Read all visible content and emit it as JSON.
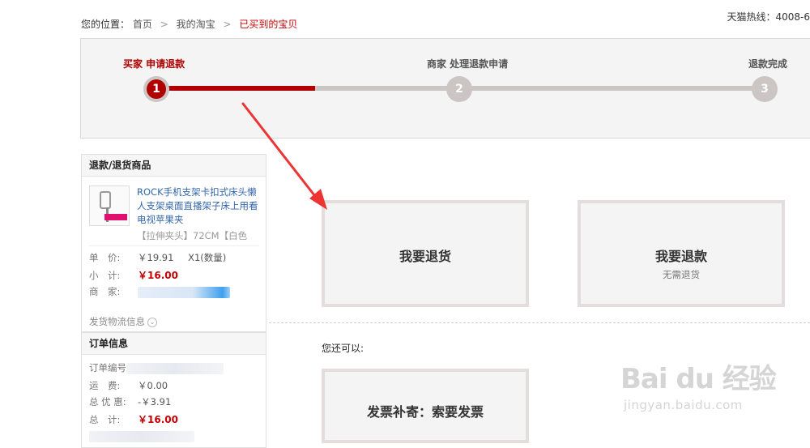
{
  "breadcrumb": {
    "label": "您的位置：",
    "items": [
      "首页",
      "我的淘宝"
    ],
    "separator": ">",
    "current": "已买到的宝贝"
  },
  "hotline": "天猫热线：4008-6",
  "steps": [
    {
      "label": "买家 申请退款",
      "number": "1",
      "state": "active"
    },
    {
      "label": "商家 处理退款申请",
      "number": "2",
      "state": "inactive"
    },
    {
      "label": "退款完成",
      "number": "3",
      "state": "inactive"
    }
  ],
  "progress": {
    "fraction": 0.26
  },
  "goods_panel": {
    "title": "退款/退货商品",
    "item_title": "ROCK手机支架卡扣式床头懒人支架桌面直播架子床上用看电视苹果夹",
    "item_spec": "【拉伸夹头】72CM【白色",
    "price_label": "单　价:",
    "price_value": "￥19.91",
    "qty": "X1(数量)",
    "subtotal_label": "小　计:",
    "subtotal_value": "￥16.00",
    "seller_label": "商　家:",
    "logistics": "发货物流信息"
  },
  "order_panel": {
    "title": "订单信息",
    "order_no_label": "订单编号:",
    "shipping_label": "运　费:",
    "shipping_value": "￥0.00",
    "discount_label": "总 优 惠:",
    "discount_value": "-￥3.91",
    "total_label": "总　计:",
    "total_value": "￥16.00"
  },
  "options": {
    "return": {
      "title": "我要退货"
    },
    "refund": {
      "title": "我要退款",
      "sub": "无需退货"
    },
    "also_label": "您还可以:",
    "invoice": {
      "title": "发票补寄：索要发票"
    }
  },
  "watermark": {
    "logo": "Bai du 经验",
    "url": "jingyan.baidu.com"
  },
  "colors": {
    "accent": "#b10000",
    "price": "#c40000",
    "track": "#cbc5c3",
    "option_border": "#e3dedb",
    "annotation_arrow": "#ee3333"
  },
  "icons": [
    "chevron-down-icon",
    "annotation-arrow-icon",
    "product-thumbnail"
  ]
}
